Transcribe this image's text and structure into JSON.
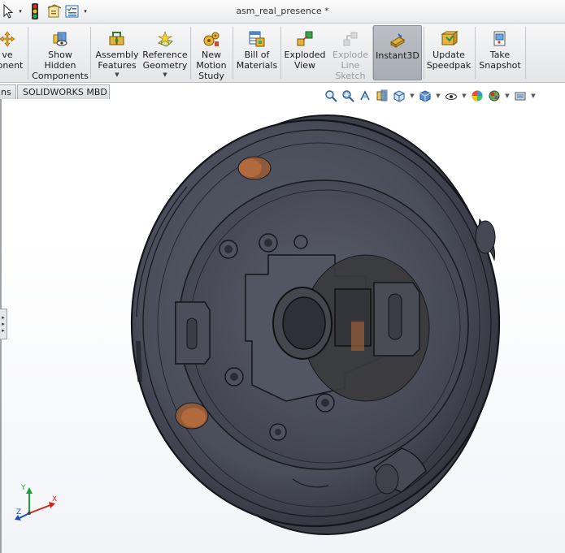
{
  "window": {
    "title": "asm_real_presence *"
  },
  "quick_access": [
    {
      "name": "select-arrow",
      "icon": "cursor-arrow-icon"
    },
    {
      "name": "rebuild",
      "icon": "traffic-light-icon"
    },
    {
      "name": "file-properties",
      "icon": "file-properties-icon"
    },
    {
      "name": "options",
      "icon": "checklist-icon"
    }
  ],
  "ribbon": {
    "items": [
      {
        "id": "move-component",
        "label": "ve\nponent",
        "icon": "move-component-icon",
        "disabled": false,
        "dropdown": false
      },
      {
        "id": "show-hidden",
        "label": "Show\nHidden\nComponents",
        "icon": "show-hidden-icon",
        "disabled": false,
        "dropdown": false
      },
      {
        "id": "assembly-features",
        "label": "Assembly\nFeatures",
        "icon": "assembly-features-icon",
        "disabled": false,
        "dropdown": true
      },
      {
        "id": "reference-geometry",
        "label": "Reference\nGeometry",
        "icon": "reference-geometry-icon",
        "disabled": false,
        "dropdown": true
      },
      {
        "id": "new-motion-study",
        "label": "New\nMotion\nStudy",
        "icon": "motion-study-icon",
        "disabled": false,
        "dropdown": false
      },
      {
        "id": "bill-of-materials",
        "label": "Bill of\nMaterials",
        "icon": "bill-of-materials-icon",
        "disabled": false,
        "dropdown": false
      },
      {
        "id": "exploded-view",
        "label": "Exploded\nView",
        "icon": "exploded-view-icon",
        "disabled": false,
        "dropdown": false
      },
      {
        "id": "explode-line-sketch",
        "label": "Explode\nLine\nSketch",
        "icon": "explode-line-sketch-icon",
        "disabled": true,
        "dropdown": false
      },
      {
        "id": "instant3d",
        "label": "Instant3D",
        "icon": "instant3d-icon",
        "disabled": false,
        "dropdown": false,
        "active": true
      },
      {
        "id": "update-speedpak",
        "label": "Update\nSpeedpak",
        "icon": "speedpak-icon",
        "disabled": false,
        "dropdown": false
      },
      {
        "id": "take-snapshot",
        "label": "Take\nSnapshot",
        "icon": "snapshot-icon",
        "disabled": false,
        "dropdown": false
      }
    ]
  },
  "tabs": [
    {
      "label": "ns",
      "id": "tab-partial"
    },
    {
      "label": "SOLIDWORKS MBD",
      "id": "tab-solidworks-mbd"
    }
  ],
  "view_toolbar": [
    {
      "icon": "zoom-to-fit-icon",
      "dropdown": false
    },
    {
      "icon": "zoom-to-area-icon",
      "dropdown": false
    },
    {
      "icon": "previous-view-icon",
      "dropdown": false
    },
    {
      "icon": "section-view-icon",
      "dropdown": false
    },
    {
      "icon": "view-orientation-icon",
      "dropdown": true
    },
    {
      "icon": "display-style-icon",
      "dropdown": true
    },
    {
      "icon": "hide-show-items-icon",
      "dropdown": true
    },
    {
      "icon": "edit-appearance-icon",
      "dropdown": false
    },
    {
      "icon": "apply-scene-icon",
      "dropdown": true
    },
    {
      "icon": "view-settings-icon",
      "dropdown": true
    }
  ],
  "triad": {
    "x": "X",
    "y": "Y",
    "z": "Z"
  },
  "colors": {
    "part_body": "#4a4c58",
    "part_edge": "#14151a",
    "accent_copper": "#b06a3e",
    "ribbon_active": "#b1b5bb"
  }
}
